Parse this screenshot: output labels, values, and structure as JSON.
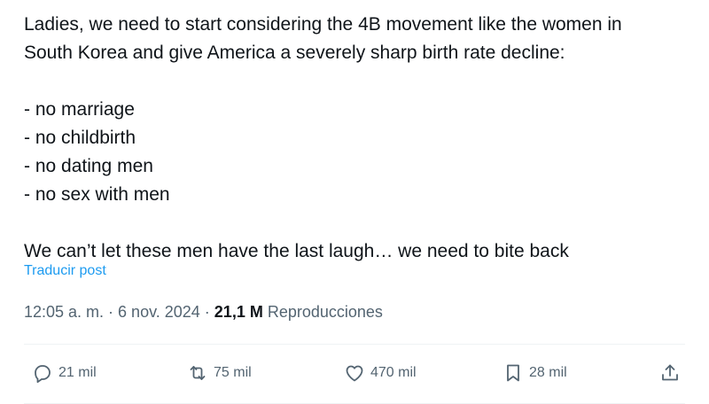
{
  "post": {
    "lines": [
      "Ladies, we need to start considering the 4B movement like the women in",
      "South Korea and give America a severely sharp birth rate decline:",
      "- no marriage",
      "- no childbirth",
      "- no dating men",
      "- no sex with men",
      "We can’t let these men have the last laugh… we need to bite back"
    ],
    "translate_label": "Traducir post",
    "timestamp": "12:05 a. m. · 6 nov. 2024 · ",
    "views_count": "21,1 M",
    "views_label": " Reproducciones"
  },
  "actions": {
    "replies": "21 mil",
    "reposts": "75 mil",
    "likes": "470 mil",
    "bookmarks": "28 mil"
  },
  "icons": {
    "reply": "speech-bubble-icon",
    "repost": "repost-arrows-icon",
    "like": "heart-icon",
    "bookmark": "bookmark-icon",
    "share": "share-upload-icon"
  },
  "colors": {
    "text": "#0f1419",
    "muted": "#536471",
    "link": "#1d9bf0"
  }
}
